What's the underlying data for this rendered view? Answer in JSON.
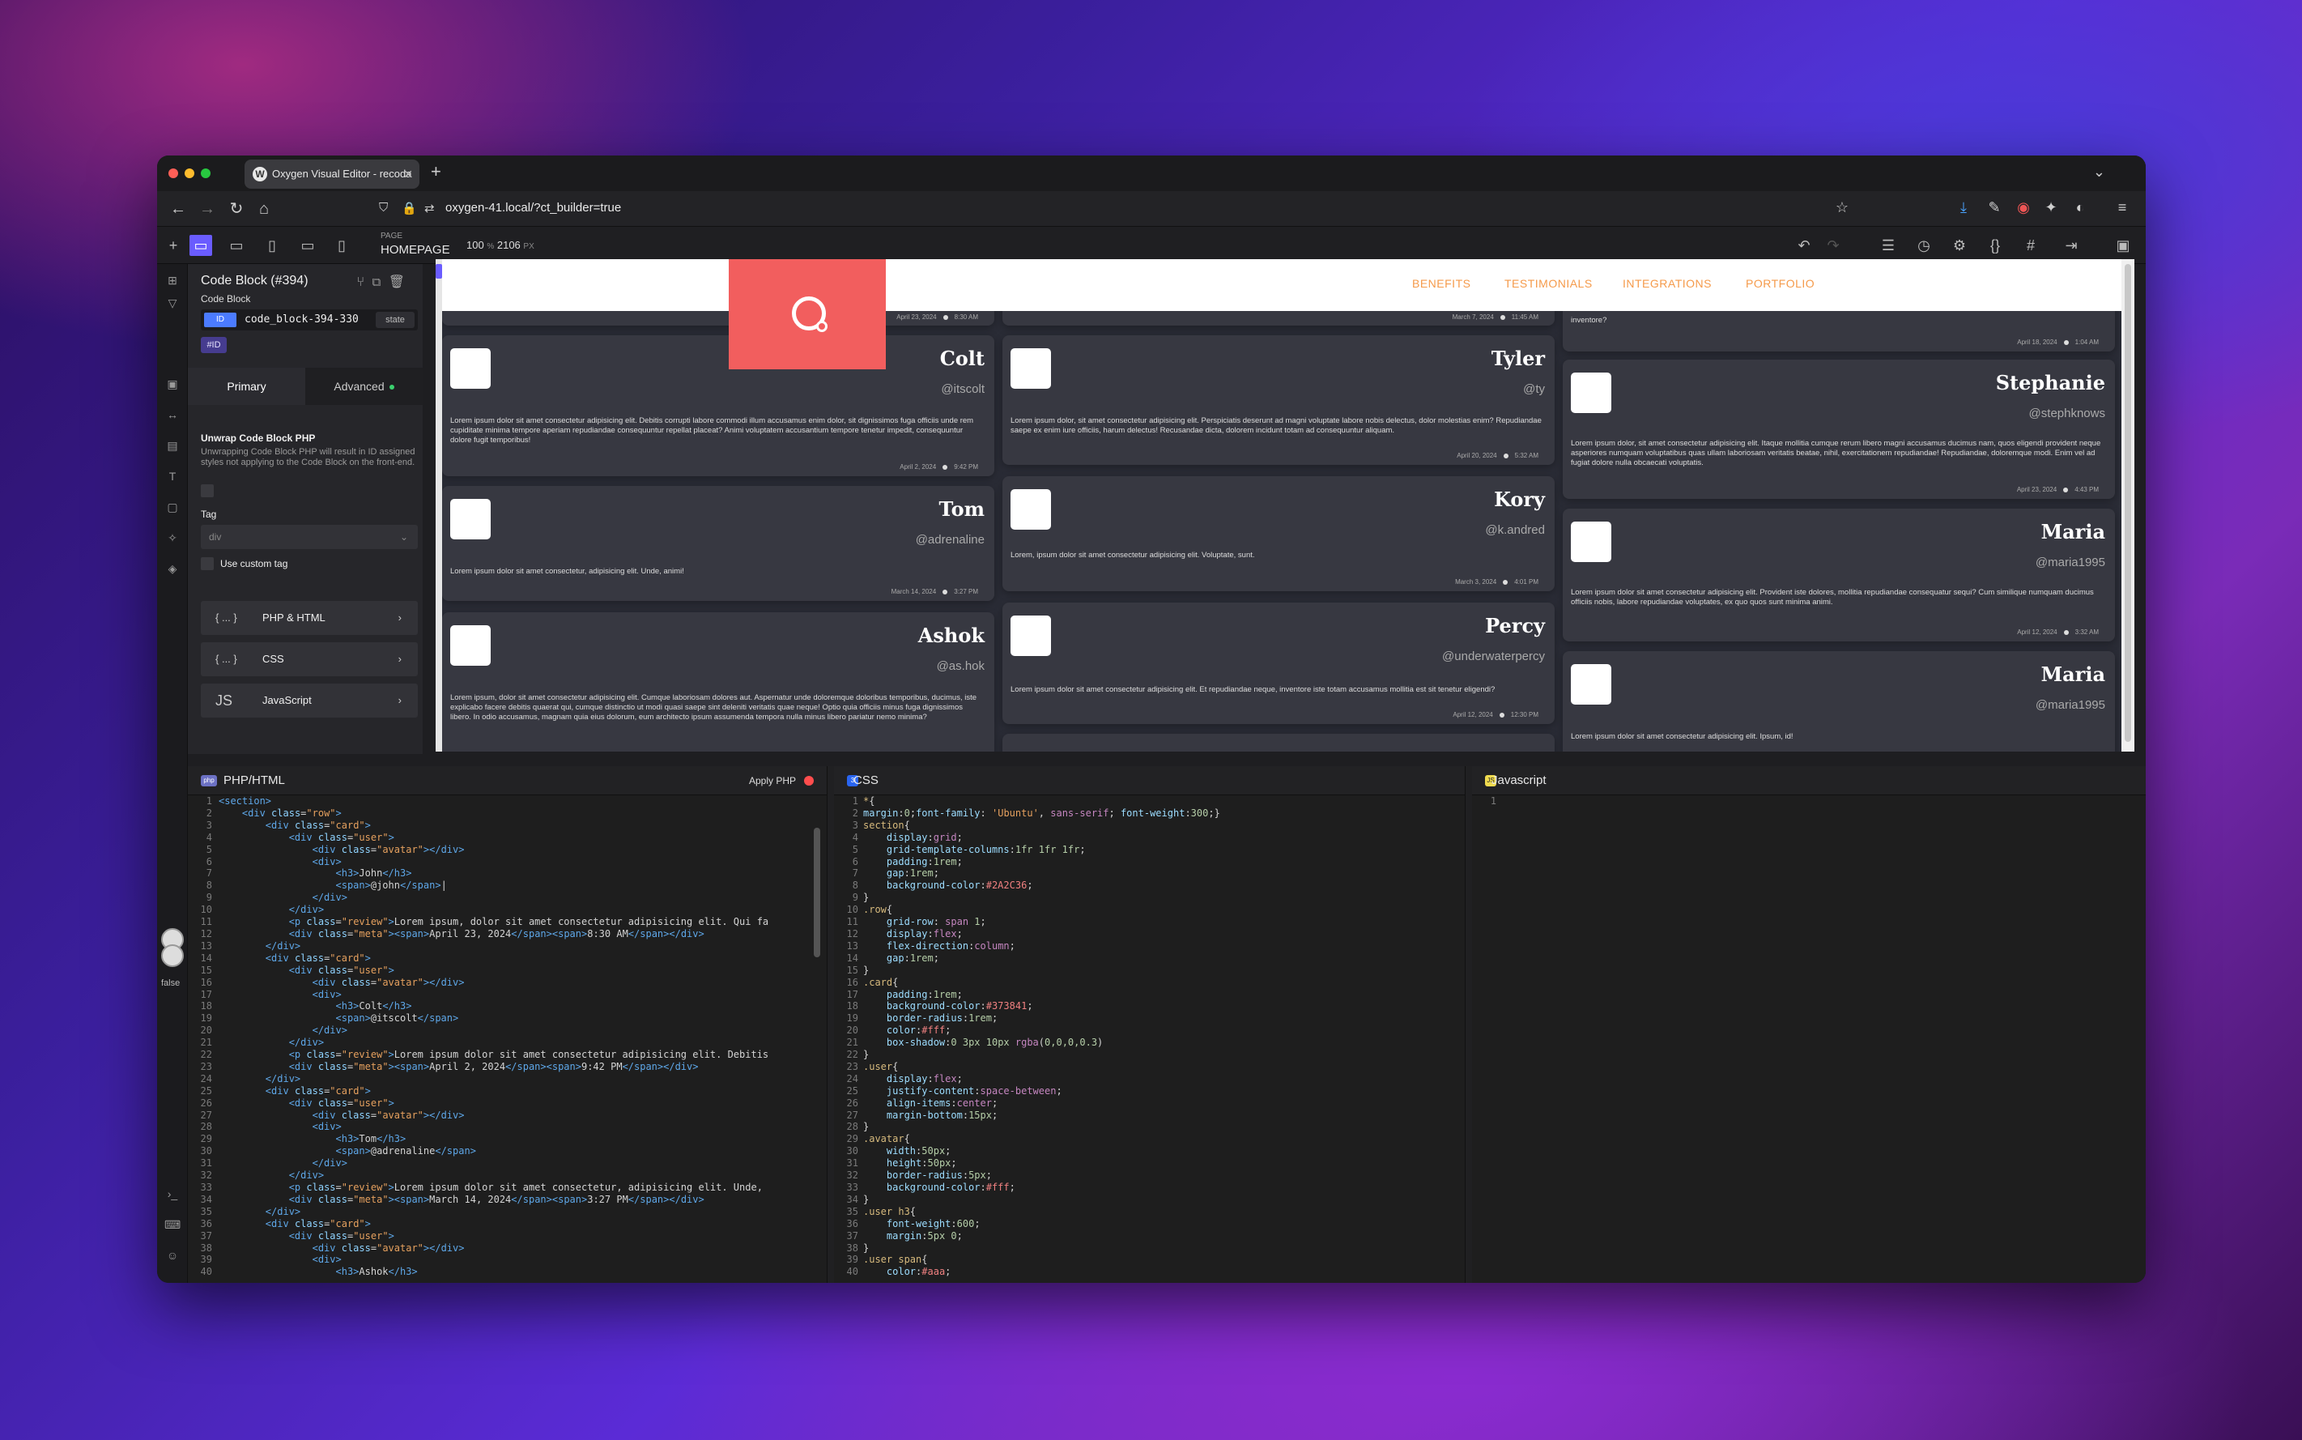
{
  "browser": {
    "tab_title": "Oxygen Visual Editor - recoda",
    "tab_close": "✕",
    "new_tab": "+",
    "url": "oxygen-41.local/?ct_builder=true"
  },
  "toolbar": {
    "page_label": "PAGE",
    "page_value": "HOMEPAGE",
    "zoom_value": "100",
    "zoom_pct": "%",
    "width_value": "2106",
    "width_unit": "PX"
  },
  "panel": {
    "title": "Code Block (#394)",
    "subtitle": "Code Block",
    "id_badge": "ID",
    "id_value": "code_block-394-330",
    "state_label": "state",
    "hash_id": "#ID",
    "tabs": [
      {
        "label": "Primary"
      },
      {
        "label": "Advanced"
      }
    ],
    "unwrap_title": "Unwrap Code Block PHP",
    "unwrap_desc": "Unwrapping Code Block PHP will result in ID assigned styles not applying to the Code Block on the front-end.",
    "tag_label": "Tag",
    "tag_value": "div",
    "custom_tag_label": "Use custom tag",
    "sections": [
      {
        "icon": "{ ... }",
        "label": "PHP & HTML"
      },
      {
        "icon": "{ ... }",
        "label": "CSS"
      },
      {
        "icon": "JS",
        "label": "JavaScript"
      }
    ]
  },
  "rail": {
    "false_label": "false"
  },
  "site": {
    "nav": [
      "BENEFITS",
      "TESTIMONIALS",
      "INTEGRATIONS",
      "PORTFOLIO"
    ],
    "top_metas": [
      "April 23, 2024",
      "8:30 AM",
      "March 7, 2024",
      "11:45 AM",
      "April 18, 2024",
      "1:04 AM"
    ],
    "top_text_col3": "inventore?",
    "cards": [
      {
        "name": "Colt",
        "handle": "@itscolt",
        "review": "Lorem ipsum dolor sit amet consectetur adipisicing elit. Debitis corrupti labore commodi illum accusamus enim dolor, sit dignissimos fuga officiis unde rem cupiditate minima tempore aperiam repudiandae consequuntur repellat placeat? Animi voluptatem accusantium tempore tenetur impedit, consequuntur dolore fugit temporibus!",
        "date": "April 2, 2024",
        "time": "9:42 PM"
      },
      {
        "name": "Tom",
        "handle": "@adrenaline",
        "review": "Lorem ipsum dolor sit amet consectetur, adipisicing elit. Unde, animi!",
        "date": "March 14, 2024",
        "time": "3:27 PM"
      },
      {
        "name": "Ashok",
        "handle": "@as.hok",
        "review": "Lorem ipsum, dolor sit amet consectetur adipisicing elit. Cumque laboriosam dolores aut. Aspernatur unde doloremque doloribus temporibus, ducimus, iste explicabo facere debitis quaerat qui, cumque distinctio ut modi quasi saepe sint deleniti veritatis quae neque! Optio quia officiis minus fuga dignissimos libero. In odio accusamus, magnam quia eius dolorum, eum architecto ipsum assumenda tempora nulla minus libero pariatur nemo minima?"
      },
      {
        "name": "Tyler",
        "handle": "@ty",
        "review": "Lorem ipsum dolor, sit amet consectetur adipisicing elit. Perspiciatis deserunt ad magni voluptate labore nobis delectus, dolor molestias enim? Repudiandae saepe ex enim iure officiis, harum delectus! Recusandae dicta, dolorem incidunt totam ad consequuntur aliquam.",
        "date": "April 20, 2024",
        "time": "5:32 AM"
      },
      {
        "name": "Kory",
        "handle": "@k.andred",
        "review": "Lorem, ipsum dolor sit amet consectetur adipisicing elit. Voluptate, sunt.",
        "date": "March 3, 2024",
        "time": "4:01 PM"
      },
      {
        "name": "Percy",
        "handle": "@underwaterpercy",
        "review": "Lorem ipsum dolor sit amet consectetur adipisicing elit. Et repudiandae neque, inventore iste totam accusamus mollitia est sit tenetur eligendi?",
        "date": "April 12, 2024",
        "time": "12:30 PM"
      },
      {
        "name": "Stephanie",
        "handle": "@stephknows",
        "review": "Lorem ipsum dolor, sit amet consectetur adipisicing elit. Itaque mollitia cumque rerum libero magni accusamus ducimus nam, quos eligendi provident neque asperiores numquam voluptatibus quas ullam laboriosam veritatis beatae, nihil, exercitationem repudiandae! Repudiandae, doloremque modi. Enim vel ad fugiat dolore nulla obcaecati voluptatis.",
        "date": "April 23, 2024",
        "time": "4:43 PM"
      },
      {
        "name": "Maria",
        "handle": "@maria1995",
        "review": "Lorem ipsum dolor sit amet consectetur adipisicing elit. Provident iste dolores, mollitia repudiandae consequatur sequi? Cum similique numquam ducimus officiis nobis, labore repudiandae voluptates, ex quo quos sunt minima animi.",
        "date": "April 12, 2024",
        "time": "3:32 AM"
      },
      {
        "name": "Maria",
        "handle": "@maria1995",
        "review": "Lorem ipsum dolor sit amet consectetur adipisicing elit. Ipsum, id!"
      }
    ]
  },
  "editors": {
    "php": {
      "title": "PHP/HTML",
      "icon": "php",
      "apply": "Apply PHP"
    },
    "css": {
      "title": "CSS"
    },
    "js": {
      "title": "Javascript",
      "line1": "1"
    }
  }
}
